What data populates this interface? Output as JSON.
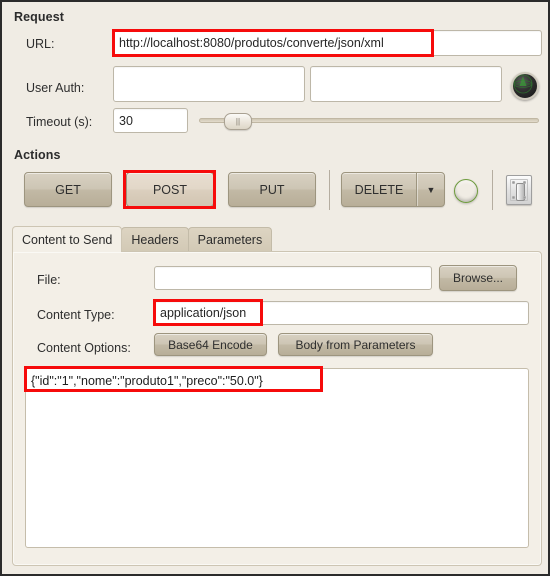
{
  "window": {
    "accent_red": "#f60b0b",
    "panel_bg": "#f0ece4",
    "button_bg": "#c6bda9"
  },
  "request": {
    "section_title": "Request",
    "url_label": "URL:",
    "url_value": "http://localhost:8080/produtos/converte/json/xml",
    "user_auth_label": "User Auth:",
    "user_auth_user": "",
    "user_auth_pass": "",
    "auth_icon": "radar-globe-icon",
    "timeout_label": "Timeout (s):",
    "timeout_value": "30",
    "slider_thumb_glyph": "||"
  },
  "actions": {
    "section_title": "Actions",
    "buttons": [
      {
        "label": "GET",
        "selected": false
      },
      {
        "label": "POST",
        "selected": true
      },
      {
        "label": "PUT",
        "selected": false
      }
    ],
    "delete_button": {
      "label": "DELETE",
      "arrow_glyph": "▼"
    },
    "status_led": {
      "name": "status-led",
      "color": "#8ccf49"
    },
    "switch_icon": "light-switch-icon"
  },
  "tabs": [
    {
      "label": "Content to Send",
      "active": true
    },
    {
      "label": "Headers",
      "active": false
    },
    {
      "label": "Parameters",
      "active": false
    }
  ],
  "content_to_send": {
    "file_label": "File:",
    "file_value": "",
    "browse_label": "Browse...",
    "content_type_label": "Content Type:",
    "content_type_value": "application/json",
    "content_options_label": "Content Options:",
    "base64_label": "Base64 Encode",
    "body_from_params_label": "Body from Parameters",
    "body_value": "{\"id\":\"1\",\"nome\":\"produto1\",\"preco\":\"50.0\"}"
  },
  "annotations": [
    {
      "name": "highlight-url-field"
    },
    {
      "name": "highlight-post-button"
    },
    {
      "name": "highlight-content-type"
    },
    {
      "name": "highlight-body-text"
    }
  ]
}
